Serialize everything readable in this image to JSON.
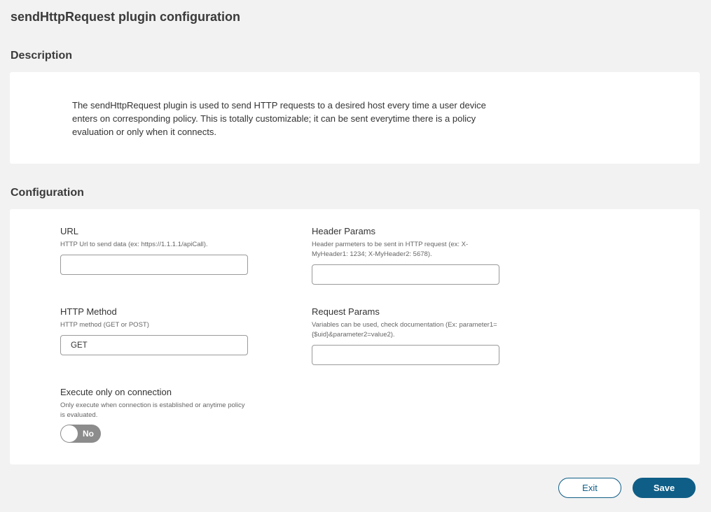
{
  "page": {
    "title": "sendHttpRequest plugin configuration"
  },
  "description": {
    "section_title": "Description",
    "text": "The sendHttpRequest plugin is used to send HTTP requests to a desired host every time a user device enters on corresponding policy. This is totally customizable; it can be sent everytime there is a policy evaluation or only when it connects."
  },
  "configuration": {
    "section_title": "Configuration",
    "url": {
      "label": "URL",
      "help": "HTTP Url to send data (ex: https://1.1.1.1/apiCall).",
      "value": ""
    },
    "header_params": {
      "label": "Header Params",
      "help": "Header parmeters to be sent in HTTP request (ex: X-MyHeader1: 1234; X-MyHeader2: 5678).",
      "value": ""
    },
    "http_method": {
      "label": "HTTP Method",
      "help": "HTTP method (GET or POST)",
      "value": "GET"
    },
    "request_params": {
      "label": "Request Params",
      "help": "Variables can be used, check documentation (Ex: parameter1={$uid}&parameter2=value2).",
      "value": ""
    },
    "execute_on_connection": {
      "label": "Execute only on connection",
      "help": "Only execute when connection is established or anytime policy is evaluated.",
      "state": "No",
      "enabled": false
    }
  },
  "actions": {
    "exit_label": "Exit",
    "save_label": "Save"
  },
  "colors": {
    "accent": "#0f5e87",
    "toggle_off": "#8c8c8c",
    "background": "#f2f2f2"
  }
}
